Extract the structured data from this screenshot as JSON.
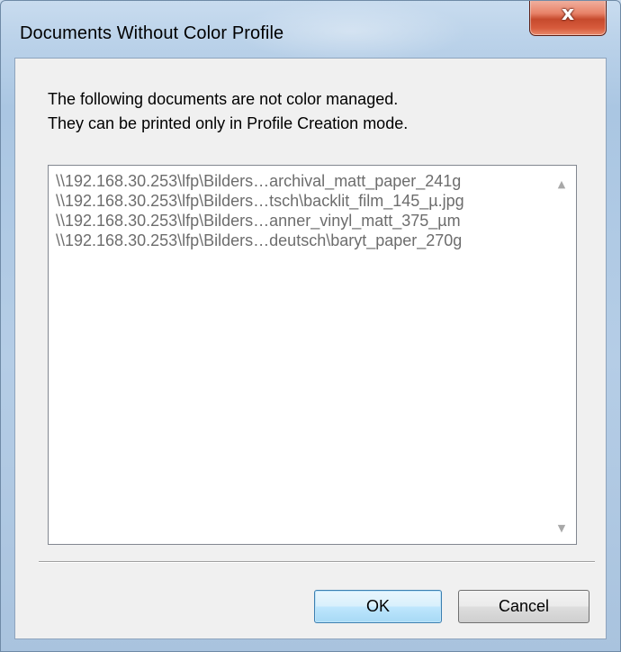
{
  "dialog": {
    "title": "Documents Without Color Profile",
    "close_label": "x",
    "message_line1": "The following documents are not color managed.",
    "message_line2": "They can be printed only in Profile Creation mode.",
    "documents": [
      "\\\\192.168.30.253\\lfp\\Bilders…archival_matt_paper_241g",
      "\\\\192.168.30.253\\lfp\\Bilders…tsch\\backlit_film_145_µ.jpg",
      "\\\\192.168.30.253\\lfp\\Bilders…anner_vinyl_matt_375_µm",
      "\\\\192.168.30.253\\lfp\\Bilders…deutsch\\baryt_paper_270g"
    ],
    "ok_label": "OK",
    "cancel_label": "Cancel"
  },
  "colors": {
    "title_bar": "#bcd3ea",
    "close_button": "#c64a2d",
    "client_background": "#f0f0f0",
    "list_text": "#6d6d6d",
    "default_button_border": "#3c7fb1"
  },
  "icons": {
    "scroll_up": "scroll-up-arrow-icon",
    "scroll_down": "scroll-down-arrow-icon",
    "close": "close-icon"
  }
}
